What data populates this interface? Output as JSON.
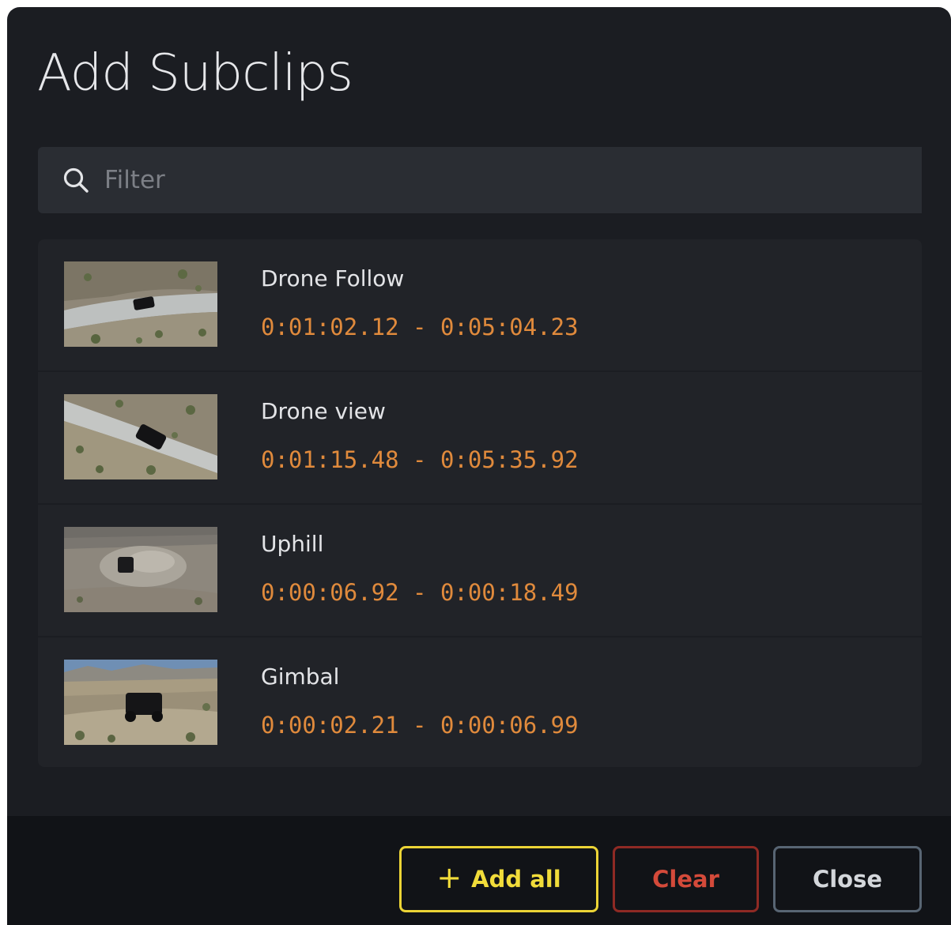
{
  "dialog": {
    "title": "Add Subclips"
  },
  "filter": {
    "placeholder": "Filter",
    "value": "",
    "icon": "search-icon"
  },
  "clips": [
    {
      "name": "Drone Follow",
      "time": "0:01:02.12 - 0:05:04.23"
    },
    {
      "name": "Drone view",
      "time": "0:01:15.48 - 0:05:35.92"
    },
    {
      "name": "Uphill",
      "time": "0:00:06.92 - 0:00:18.49"
    },
    {
      "name": "Gimbal",
      "time": "0:00:02.21 - 0:00:06.99"
    }
  ],
  "footer": {
    "add_all_label": "Add all",
    "add_all_icon": "plus-icon",
    "clear_label": "Clear",
    "close_label": "Close"
  },
  "colors": {
    "background": "#1b1d22",
    "timecode": "#e08a3c",
    "add_all_accent": "#ecd436",
    "clear_accent": "#d44a3a",
    "close_border": "#586573"
  }
}
